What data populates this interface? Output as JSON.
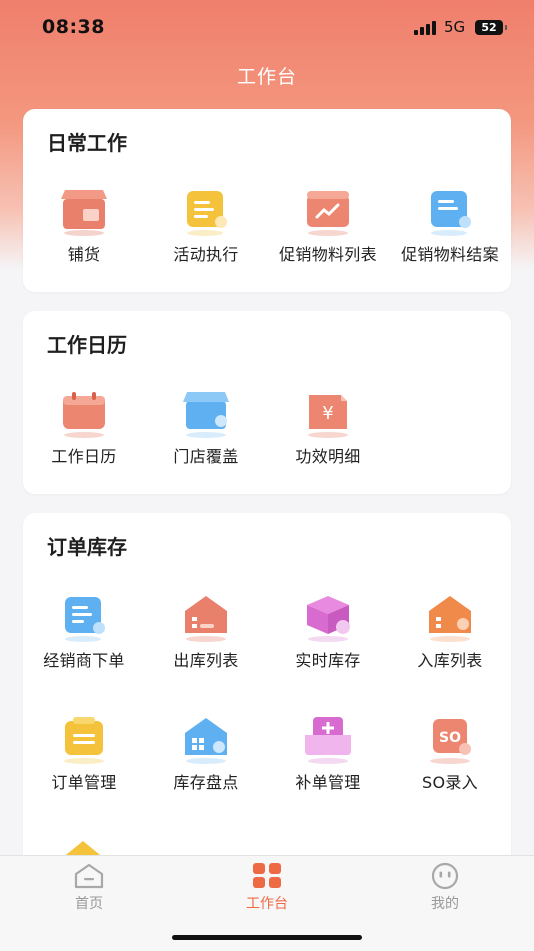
{
  "status_bar": {
    "time": "08:38",
    "network": "5G",
    "battery": "52"
  },
  "header": {
    "title": "工作台"
  },
  "sections": [
    {
      "title": "日常工作",
      "items": [
        {
          "label": "铺货",
          "icon": "shop-icon"
        },
        {
          "label": "活动执行",
          "icon": "activity-doc-icon"
        },
        {
          "label": "促销物料列表",
          "icon": "promo-chart-icon"
        },
        {
          "label": "促销物料结案",
          "icon": "promo-close-doc-icon"
        }
      ]
    },
    {
      "title": "工作日历",
      "items": [
        {
          "label": "工作日历",
          "icon": "calendar-icon"
        },
        {
          "label": "门店覆盖",
          "icon": "store-coverage-icon"
        },
        {
          "label": "功效明细",
          "icon": "yuan-detail-icon"
        }
      ]
    },
    {
      "title": "订单库存",
      "items": [
        {
          "label": "经销商下单",
          "icon": "dealer-order-icon"
        },
        {
          "label": "出库列表",
          "icon": "outbound-warehouse-icon"
        },
        {
          "label": "实时库存",
          "icon": "realtime-stock-icon"
        },
        {
          "label": "入库列表",
          "icon": "inbound-warehouse-icon"
        },
        {
          "label": "订单管理",
          "icon": "order-manage-icon"
        },
        {
          "label": "库存盘点",
          "icon": "stock-check-icon"
        },
        {
          "label": "补单管理",
          "icon": "reorder-icon"
        },
        {
          "label": "SO录入",
          "icon": "so-entry-icon"
        }
      ]
    }
  ],
  "tabbar": {
    "items": [
      {
        "label": "首页",
        "icon": "home-icon",
        "active": false
      },
      {
        "label": "工作台",
        "icon": "grid-icon",
        "active": true
      },
      {
        "label": "我的",
        "icon": "profile-face-icon",
        "active": false
      }
    ]
  },
  "colors": {
    "accent": "#ee6a45",
    "header_gradient_top": "#ef7f6c",
    "tab_inactive": "#999999"
  }
}
